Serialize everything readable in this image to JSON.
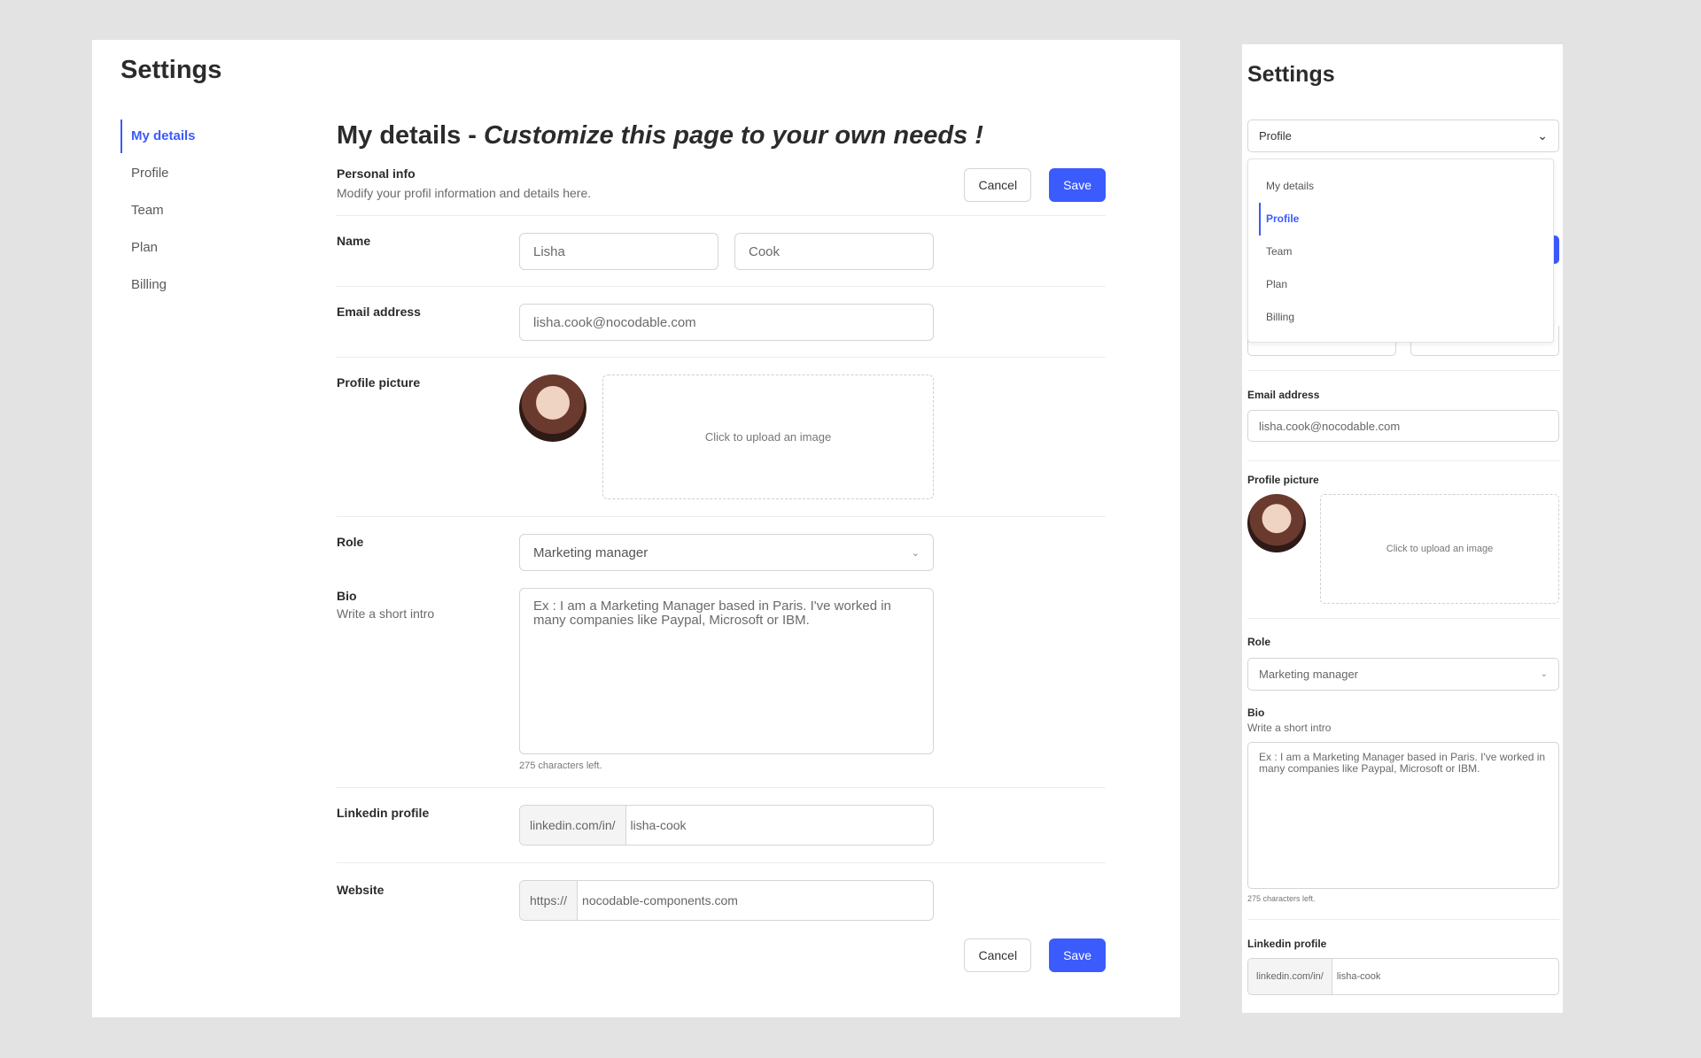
{
  "settings_title": "Settings",
  "sidebar": {
    "items": [
      {
        "label": "My details"
      },
      {
        "label": "Profile"
      },
      {
        "label": "Team"
      },
      {
        "label": "Plan"
      },
      {
        "label": "Billing"
      }
    ]
  },
  "main": {
    "heading": "My details - ",
    "heading_italic": "Customize this page to your own needs !",
    "personal_info_title": "Personal info",
    "personal_info_desc": "Modify your profil information and details here.",
    "cancel_label": "Cancel",
    "save_label": "Save",
    "name_label": "Name",
    "first_name": "Lisha",
    "last_name": "Cook",
    "email_label": "Email address",
    "email_value": "lisha.cook@nocodable.com",
    "profile_picture_label": "Profile picture",
    "upload_text": "Click to upload an image",
    "role_label": "Role",
    "role_value": "Marketing manager",
    "bio_label": "Bio",
    "bio_sub": "Write a short intro",
    "bio_placeholder": "Ex : I am a Marketing Manager based in Paris. I've worked in many companies like Paypal, Microsoft or IBM.",
    "chars_left": "275 characters left.",
    "linkedin_label": "Linkedin profile",
    "linkedin_prefix": "linkedin.com/in/",
    "linkedin_value": "lisha-cook",
    "website_label": "Website",
    "website_prefix": "https://",
    "website_value": "nocodable-components.com"
  },
  "mobile": {
    "select_value": "Profile",
    "menu": [
      {
        "label": "My details"
      },
      {
        "label": "Profile"
      },
      {
        "label": "Team"
      },
      {
        "label": "Plan"
      },
      {
        "label": "Billing"
      }
    ]
  },
  "icons": {
    "chevron": "chevron-down-icon"
  },
  "colors": {
    "accent": "#3b5bfd",
    "background": "#e3e3e3",
    "panel": "#ffffff"
  }
}
